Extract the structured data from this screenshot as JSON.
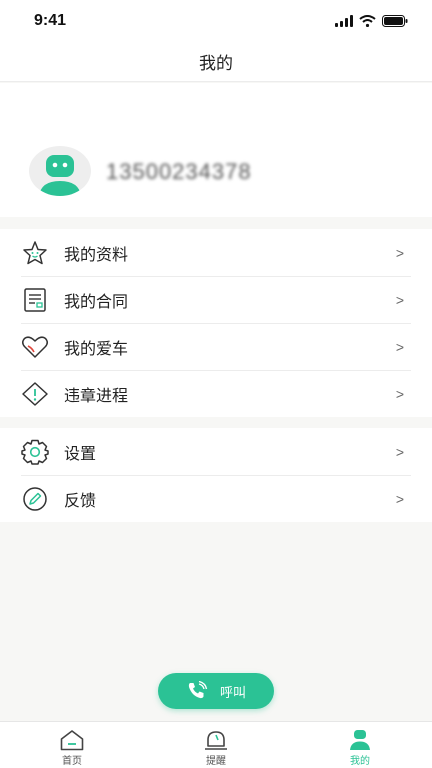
{
  "status_bar": {
    "time": "9:41"
  },
  "header": {
    "title": "我的"
  },
  "profile": {
    "phone": "13500234378"
  },
  "menu_group_1": [
    {
      "label": "我的资料",
      "icon": "star-face-icon"
    },
    {
      "label": "我的合同",
      "icon": "document-icon"
    },
    {
      "label": "我的爱车",
      "icon": "heart-icon"
    },
    {
      "label": "违章进程",
      "icon": "warning-icon"
    }
  ],
  "menu_group_2": [
    {
      "label": "设置",
      "icon": "gear-icon"
    },
    {
      "label": "反馈",
      "icon": "pencil-icon"
    }
  ],
  "chevron": ">",
  "call_button": {
    "label": "呼叫"
  },
  "tabs": [
    {
      "label": "首页",
      "icon": "home-icon"
    },
    {
      "label": "提醒",
      "icon": "bell-icon"
    },
    {
      "label": "我的",
      "icon": "user-icon"
    }
  ],
  "colors": {
    "accent": "#2bc295",
    "background": "#f7f7f5"
  }
}
